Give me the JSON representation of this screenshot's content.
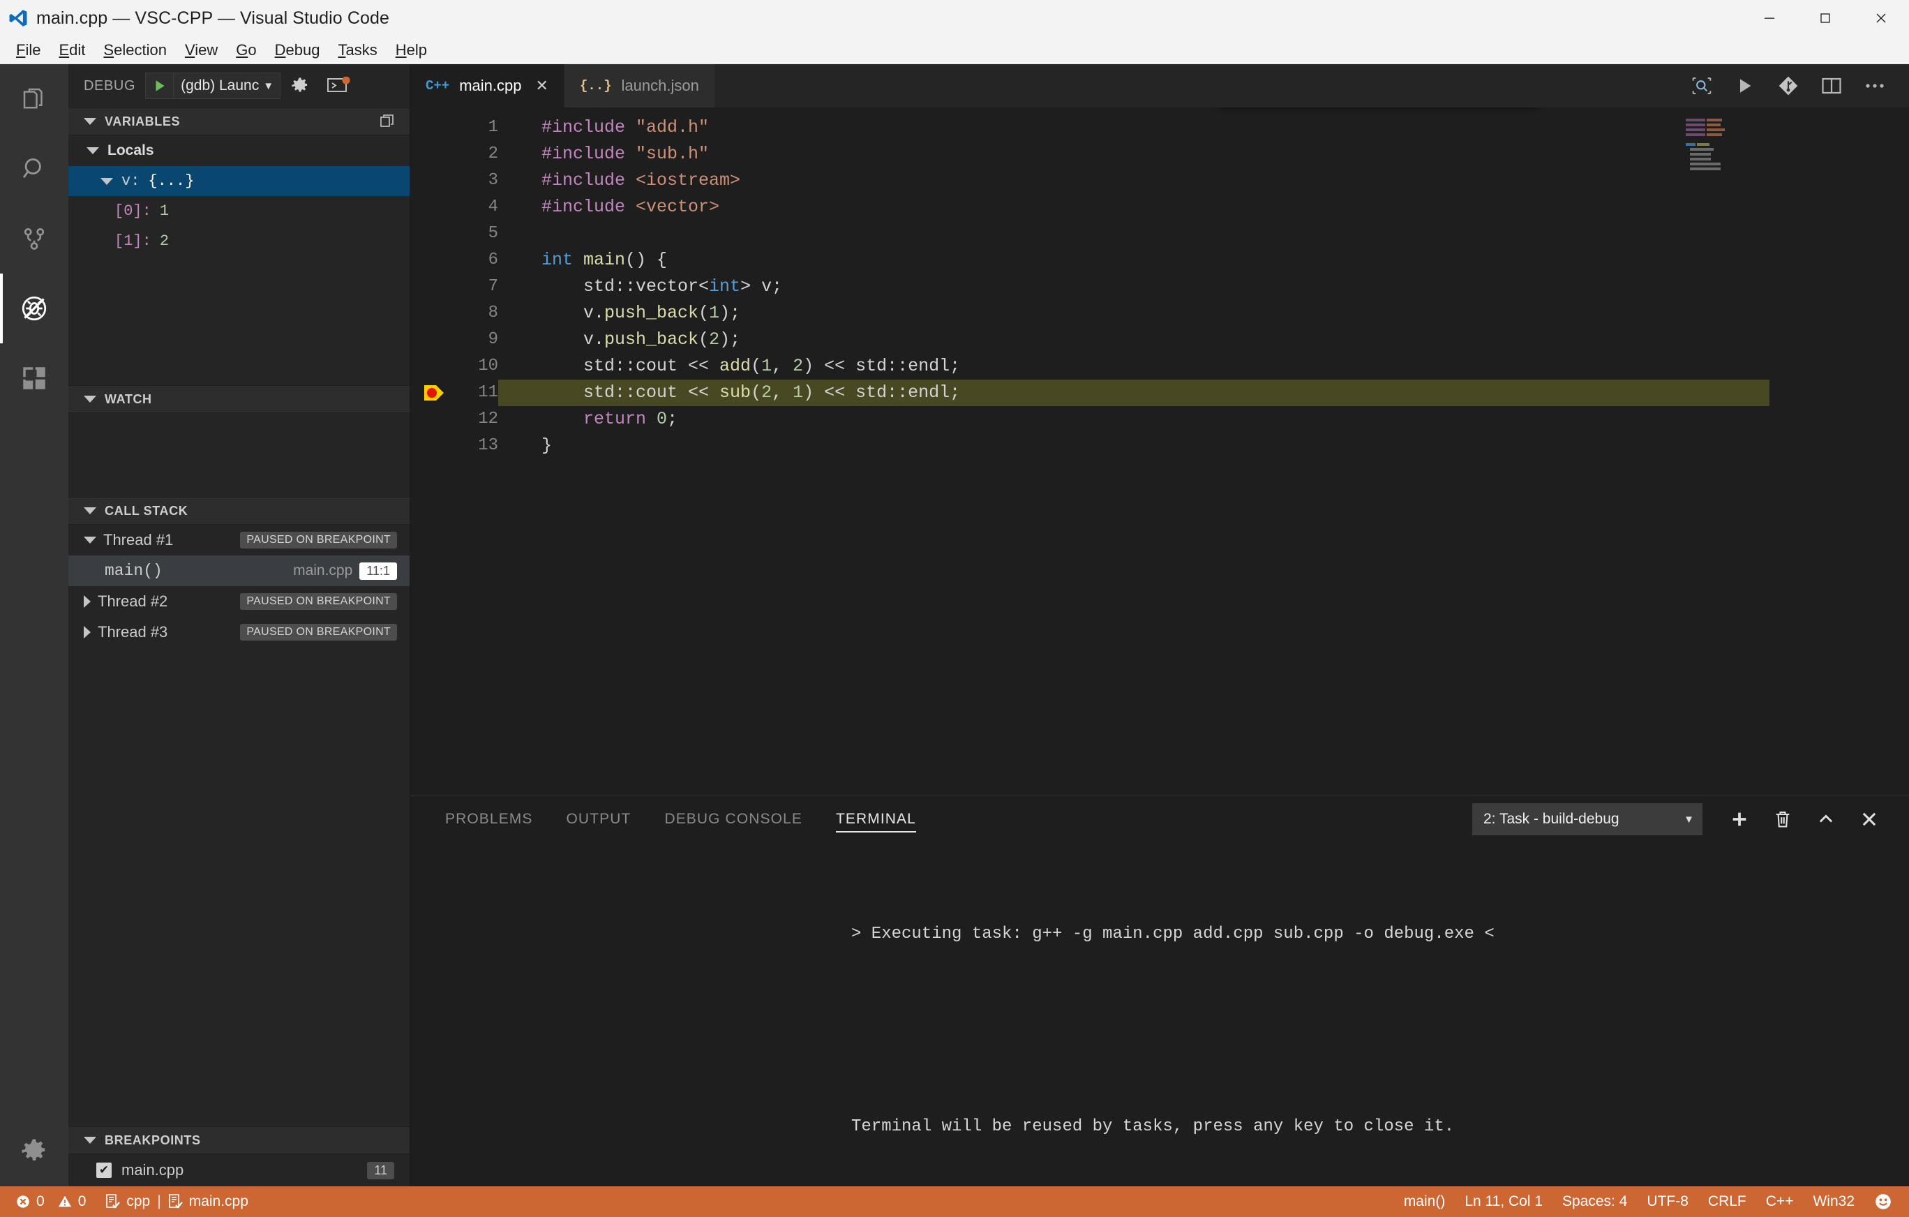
{
  "window": {
    "title": "main.cpp — VSC-CPP — Visual Studio Code",
    "minimize": "—",
    "maximize": "▢",
    "close": "✕"
  },
  "menubar": [
    {
      "label": "File"
    },
    {
      "label": "Edit"
    },
    {
      "label": "Selection"
    },
    {
      "label": "View"
    },
    {
      "label": "Go"
    },
    {
      "label": "Debug"
    },
    {
      "label": "Tasks"
    },
    {
      "label": "Help"
    }
  ],
  "activitybar": [
    {
      "name": "explorer-icon",
      "title": "Explorer"
    },
    {
      "name": "search-icon",
      "title": "Search"
    },
    {
      "name": "source-control-icon",
      "title": "Source Control"
    },
    {
      "name": "debug-icon",
      "title": "Debug",
      "active": true
    },
    {
      "name": "extensions-icon",
      "title": "Extensions"
    },
    {
      "name": "settings-gear-icon",
      "title": "Manage"
    }
  ],
  "debug_header": {
    "label": "DEBUG",
    "config": "(gdb) Launc",
    "caret": "▼",
    "start_icon": "play-icon",
    "gear_icon": "gear-icon",
    "console_icon": "open-debug-console-icon"
  },
  "sections": {
    "variables": {
      "title": "VARIABLES",
      "scope": "Locals",
      "rows": [
        {
          "name": "v:",
          "value": "{...}",
          "selected": true,
          "expanded": true
        },
        {
          "index": "[0]:",
          "value": "1"
        },
        {
          "index": "[1]:",
          "value": "2"
        }
      ]
    },
    "watch": {
      "title": "WATCH",
      "rows": []
    },
    "callstack": {
      "title": "CALL STACK",
      "rows": [
        {
          "label": "Thread #1",
          "badge": "PAUSED ON BREAKPOINT",
          "expanded": true
        },
        {
          "label": "main()",
          "file": "main.cpp",
          "position": "11:1",
          "selected": true,
          "frame": true
        },
        {
          "label": "Thread #2",
          "badge": "PAUSED ON BREAKPOINT",
          "expanded": false
        },
        {
          "label": "Thread #3",
          "badge": "PAUSED ON BREAKPOINT",
          "expanded": false
        }
      ]
    },
    "breakpoints": {
      "title": "BREAKPOINTS",
      "rows": [
        {
          "checked": true,
          "check_glyph": "✔",
          "file": "main.cpp",
          "line": "11"
        }
      ]
    }
  },
  "editor": {
    "tabs": [
      {
        "label": "main.cpp",
        "icon": "C++",
        "icon_name": "cpp-file-icon",
        "active": true,
        "close": "✕"
      },
      {
        "label": "launch.json",
        "icon": "{..}",
        "icon_name": "json-file-icon",
        "active": false
      }
    ],
    "actions": [
      {
        "name": "find-in-file-icon"
      },
      {
        "name": "run-code-icon"
      },
      {
        "name": "git-graph-icon"
      },
      {
        "name": "split-editor-icon"
      },
      {
        "name": "more-actions-icon"
      }
    ],
    "debug_toolbar": [
      {
        "name": "drag-handle-icon"
      },
      {
        "name": "continue-icon"
      },
      {
        "name": "step-over-icon"
      },
      {
        "name": "step-into-icon"
      },
      {
        "name": "step-out-icon"
      },
      {
        "name": "restart-icon"
      },
      {
        "name": "stop-icon"
      }
    ],
    "breakpoint_line": 11,
    "lines": [
      {
        "n": "1",
        "tokens": [
          {
            "t": "#include ",
            "c": "kw"
          },
          {
            "t": "\"add.h\"",
            "c": "str"
          }
        ]
      },
      {
        "n": "2",
        "tokens": [
          {
            "t": "#include ",
            "c": "kw"
          },
          {
            "t": "\"sub.h\"",
            "c": "str"
          }
        ]
      },
      {
        "n": "3",
        "tokens": [
          {
            "t": "#include ",
            "c": "kw"
          },
          {
            "t": "<iostream>",
            "c": "str"
          }
        ]
      },
      {
        "n": "4",
        "tokens": [
          {
            "t": "#include ",
            "c": "kw"
          },
          {
            "t": "<vector>",
            "c": "str"
          }
        ]
      },
      {
        "n": "5",
        "tokens": []
      },
      {
        "n": "6",
        "tokens": [
          {
            "t": "int ",
            "c": "typ"
          },
          {
            "t": "main",
            "c": "fn"
          },
          {
            "t": "() {",
            "c": "pl"
          }
        ]
      },
      {
        "n": "7",
        "tokens": [
          {
            "t": "    std::vector<",
            "c": "pl"
          },
          {
            "t": "int",
            "c": "typ"
          },
          {
            "t": "> v;",
            "c": "pl"
          }
        ]
      },
      {
        "n": "8",
        "tokens": [
          {
            "t": "    v.",
            "c": "pl"
          },
          {
            "t": "push_back",
            "c": "fn"
          },
          {
            "t": "(",
            "c": "pl"
          },
          {
            "t": "1",
            "c": "num"
          },
          {
            "t": ");",
            "c": "pl"
          }
        ]
      },
      {
        "n": "9",
        "tokens": [
          {
            "t": "    v.",
            "c": "pl"
          },
          {
            "t": "push_back",
            "c": "fn"
          },
          {
            "t": "(",
            "c": "pl"
          },
          {
            "t": "2",
            "c": "num"
          },
          {
            "t": ");",
            "c": "pl"
          }
        ]
      },
      {
        "n": "10",
        "tokens": [
          {
            "t": "    std::cout << ",
            "c": "pl"
          },
          {
            "t": "add",
            "c": "fn"
          },
          {
            "t": "(",
            "c": "pl"
          },
          {
            "t": "1",
            "c": "num"
          },
          {
            "t": ", ",
            "c": "pl"
          },
          {
            "t": "2",
            "c": "num"
          },
          {
            "t": ") << std::endl;",
            "c": "pl"
          }
        ]
      },
      {
        "n": "11",
        "highlight": true,
        "breakpoint": true,
        "tokens": [
          {
            "t": "    std::cout << ",
            "c": "pl"
          },
          {
            "t": "sub",
            "c": "fn"
          },
          {
            "t": "(",
            "c": "pl"
          },
          {
            "t": "2",
            "c": "num"
          },
          {
            "t": ", ",
            "c": "pl"
          },
          {
            "t": "1",
            "c": "num"
          },
          {
            "t": ") << std::endl;",
            "c": "pl"
          }
        ]
      },
      {
        "n": "12",
        "tokens": [
          {
            "t": "    ",
            "c": "pl"
          },
          {
            "t": "return ",
            "c": "kw"
          },
          {
            "t": "0",
            "c": "num"
          },
          {
            "t": ";",
            "c": "pl"
          }
        ]
      },
      {
        "n": "13",
        "tokens": [
          {
            "t": "}",
            "c": "pl"
          }
        ]
      }
    ]
  },
  "panel": {
    "tabs": [
      {
        "label": "PROBLEMS",
        "active": false
      },
      {
        "label": "OUTPUT",
        "active": false
      },
      {
        "label": "DEBUG CONSOLE",
        "active": false
      },
      {
        "label": "TERMINAL",
        "active": true
      }
    ],
    "task_select": {
      "value": "2: Task - build-debug",
      "caret": "▼"
    },
    "actions": [
      {
        "name": "new-terminal-icon",
        "glyph": "+"
      },
      {
        "name": "kill-terminal-icon",
        "glyph": "trash"
      },
      {
        "name": "maximize-panel-icon",
        "glyph": "^"
      },
      {
        "name": "close-panel-icon",
        "glyph": "✕"
      }
    ],
    "terminal_lines": [
      "> Executing task: g++ -g main.cpp add.cpp sub.cpp -o debug.exe <",
      "",
      "",
      "Terminal will be reused by tasks, press any key to close it."
    ]
  },
  "statusbar": {
    "errors": "0",
    "warnings": "0",
    "cpp_label": "cpp",
    "separator": "|",
    "file_label": "main.cpp",
    "function": "main()",
    "position": "Ln 11, Col 1",
    "indent": "Spaces: 4",
    "encoding": "UTF-8",
    "eol": "CRLF",
    "language": "C++",
    "platform": "Win32",
    "feedback": "☺"
  },
  "colors": {
    "titlebar_bg": "#f3f3f3",
    "activitybar_bg": "#333333",
    "sidebar_bg": "#252526",
    "editor_bg": "#1e1e1e",
    "statusbar_bg": "#cc6633",
    "selection_blue": "#094771",
    "breakpoint_red": "#e51400",
    "exec_arrow_yellow": "#ffcc00",
    "highlight_line": "#6b6b28"
  }
}
